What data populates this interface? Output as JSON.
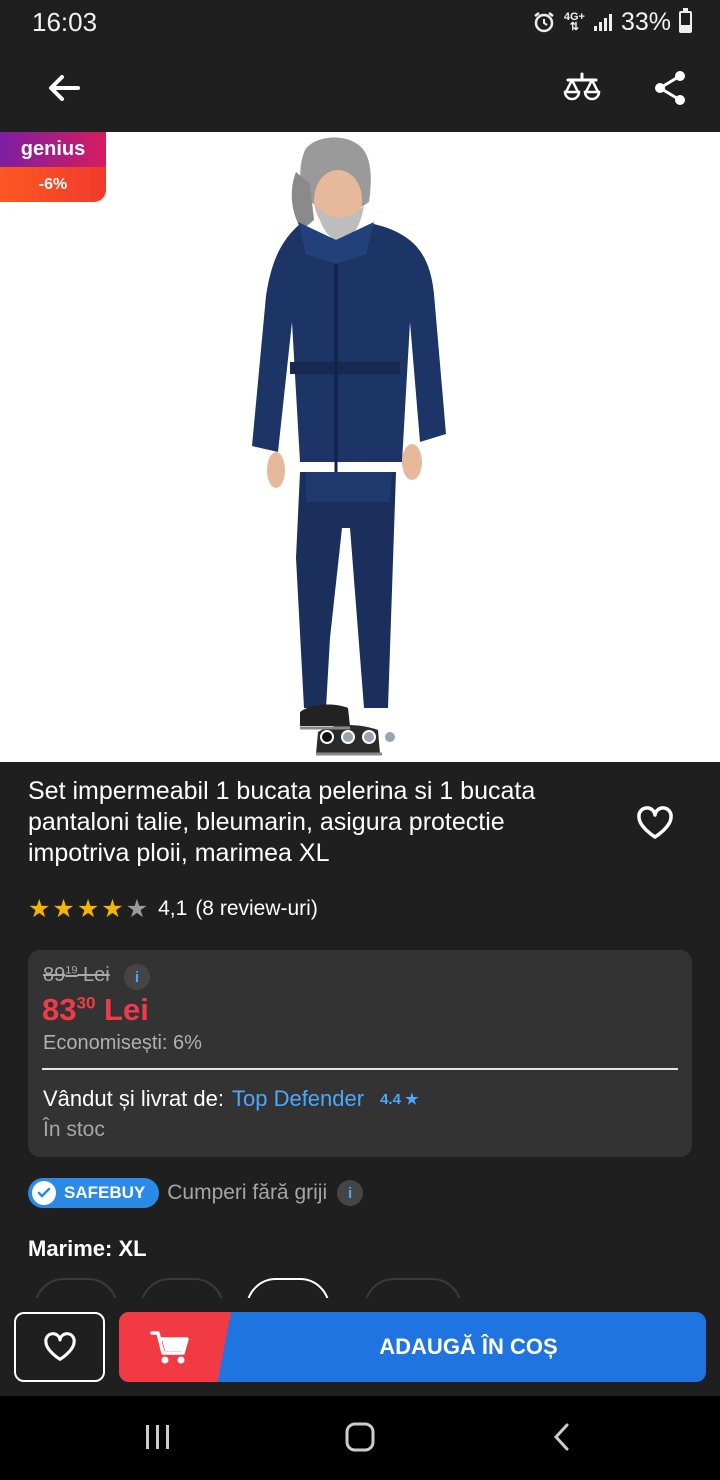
{
  "status_bar": {
    "time": "16:03",
    "network": "4G+",
    "battery": "33%"
  },
  "product": {
    "badge_genius": "genius",
    "badge_discount": "-6%",
    "title": "Set impermeabil 1 bucata pelerina si 1 bucata pantaloni talie, bleumarin, asigura protectie impotriva ploii, marimea XL",
    "rating_value": "4,1",
    "rating_stars": 4.1,
    "rating_count": "(8 review-uri)",
    "image_count": 4,
    "active_image": 1
  },
  "price": {
    "old_main": "89",
    "old_cents": "19",
    "old_currency": " Lei",
    "new_main": "83",
    "new_cents": "30",
    "new_currency": " Lei",
    "savings": "Economisești: 6%",
    "info": "i"
  },
  "seller": {
    "label": "Vândut și livrat de:",
    "name": "Top Defender",
    "rating": "4.4 ★",
    "stock": "În stoc"
  },
  "safebuy": {
    "badge": "SAFEBUY",
    "text": "Cumperi fără griji",
    "info": "i"
  },
  "size": {
    "label": "Marime: XL"
  },
  "actions": {
    "add_to_cart": "ADAUGĂ ÎN COȘ"
  },
  "colors": {
    "accent_blue": "#1f74e0",
    "sale_red": "#f23a4b",
    "link_blue": "#4aa8ff",
    "star": "#f5b400"
  }
}
